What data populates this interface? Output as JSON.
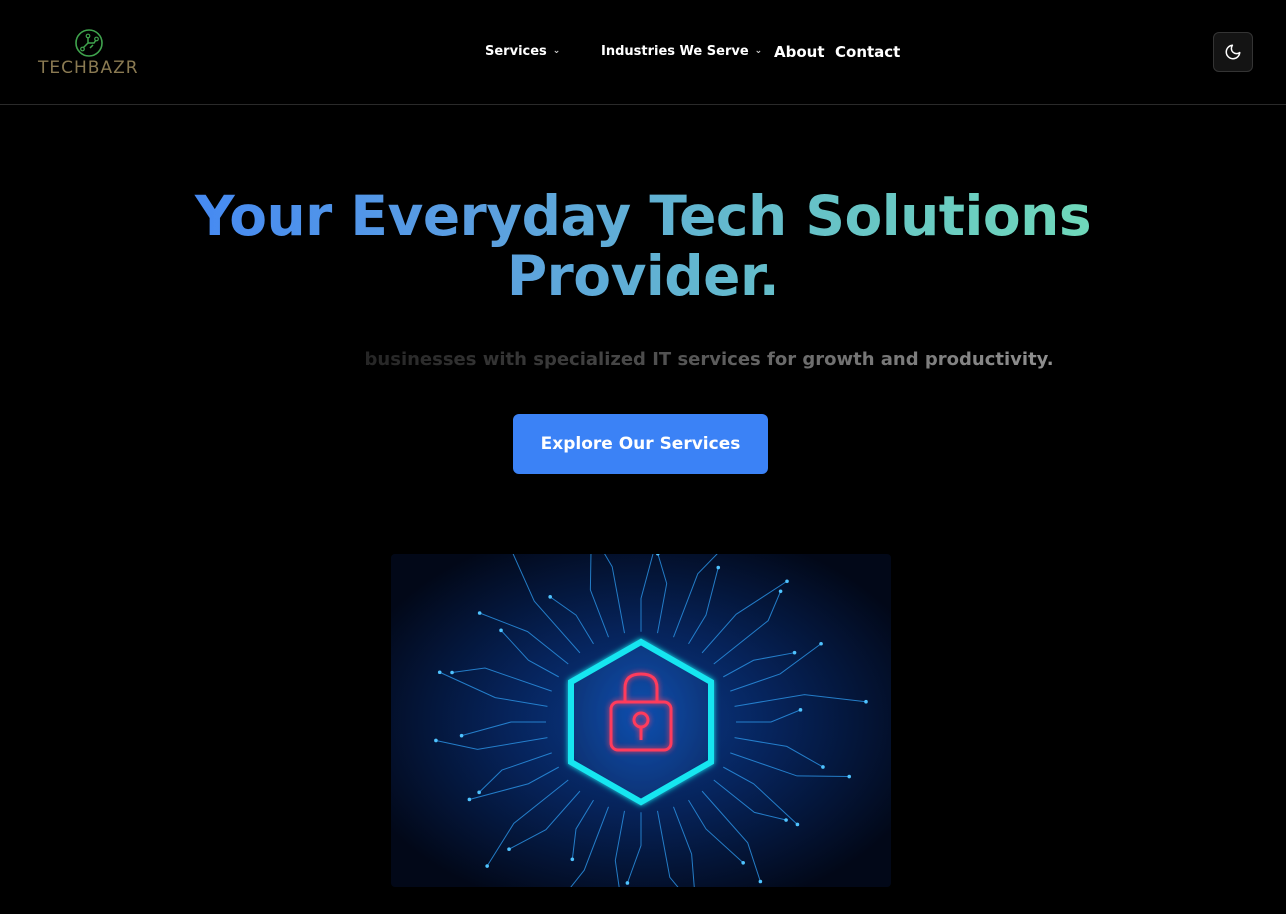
{
  "header": {
    "logo_text": "TECHBAZR",
    "nav": [
      {
        "label": "Services",
        "has_dropdown": true
      },
      {
        "label": "Industries We Serve",
        "has_dropdown": true
      },
      {
        "label": "About",
        "has_dropdown": false
      },
      {
        "label": "Contact",
        "has_dropdown": false
      }
    ],
    "theme_toggle_icon": "moon-icon"
  },
  "hero": {
    "title_line1": "Your Everyday Tech Solutions",
    "title_line2": "Provider.",
    "subtitle": "Empowering businesses with specialized IT services for growth and productivity.",
    "cta_label": "Explore Our Services",
    "image_icon": "padlock-icon"
  },
  "colors": {
    "background": "#000000",
    "accent": "#3b82f6",
    "gradient_start": "#3f83f8",
    "gradient_end": "#72e0b5",
    "logo_green": "#3fa34d",
    "neon_cyan": "#19e6f0",
    "neon_red": "#ff3a5c"
  }
}
